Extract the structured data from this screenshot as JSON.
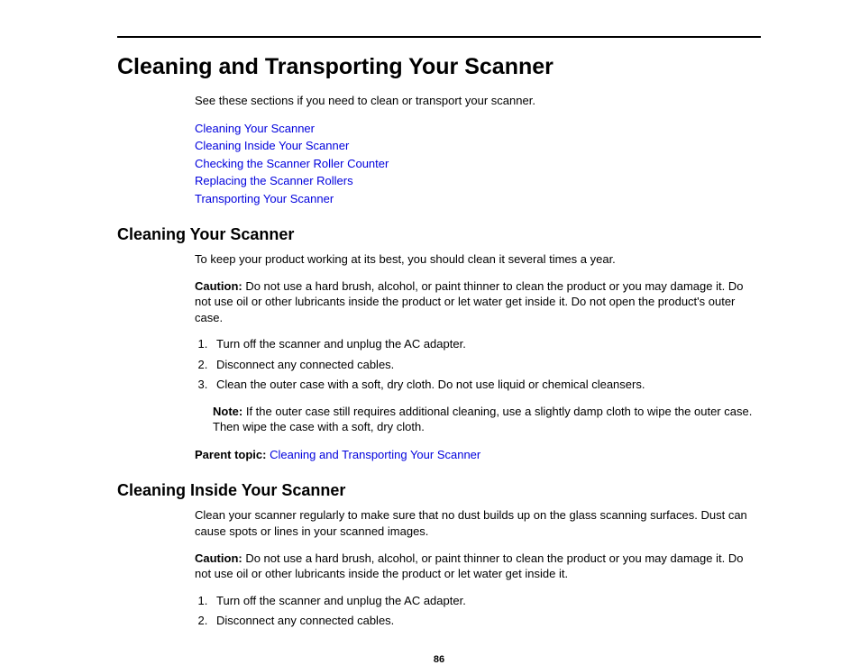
{
  "page_number": "86",
  "h1": "Cleaning and Transporting Your Scanner",
  "intro": "See these sections if you need to clean or transport your scanner.",
  "toc_links": [
    "Cleaning Your Scanner",
    "Cleaning Inside Your Scanner",
    "Checking the Scanner Roller Counter",
    "Replacing the Scanner Rollers",
    "Transporting Your Scanner"
  ],
  "section1": {
    "heading": "Cleaning Your Scanner",
    "p1": "To keep your product working at its best, you should clean it several times a year.",
    "caution_label": "Caution:",
    "caution_text": " Do not use a hard brush, alcohol, or paint thinner to clean the product or you may damage it. Do not use oil or other lubricants inside the product or let water get inside it. Do not open the product's outer case.",
    "steps": [
      "Turn off the scanner and unplug the AC adapter.",
      "Disconnect any connected cables.",
      "Clean the outer case with a soft, dry cloth. Do not use liquid or chemical cleansers."
    ],
    "note_label": "Note:",
    "note_text": " If the outer case still requires additional cleaning, use a slightly damp cloth to wipe the outer case. Then wipe the case with a soft, dry cloth.",
    "parent_label": "Parent topic:",
    "parent_link": " Cleaning and Transporting Your Scanner"
  },
  "section2": {
    "heading": "Cleaning Inside Your Scanner",
    "p1": "Clean your scanner regularly to make sure that no dust builds up on the glass scanning surfaces. Dust can cause spots or lines in your scanned images.",
    "caution_label": "Caution:",
    "caution_text": " Do not use a hard brush, alcohol, or paint thinner to clean the product or you may damage it. Do not use oil or other lubricants inside the product or let water get inside it.",
    "steps": [
      "Turn off the scanner and unplug the AC adapter.",
      "Disconnect any connected cables."
    ]
  }
}
